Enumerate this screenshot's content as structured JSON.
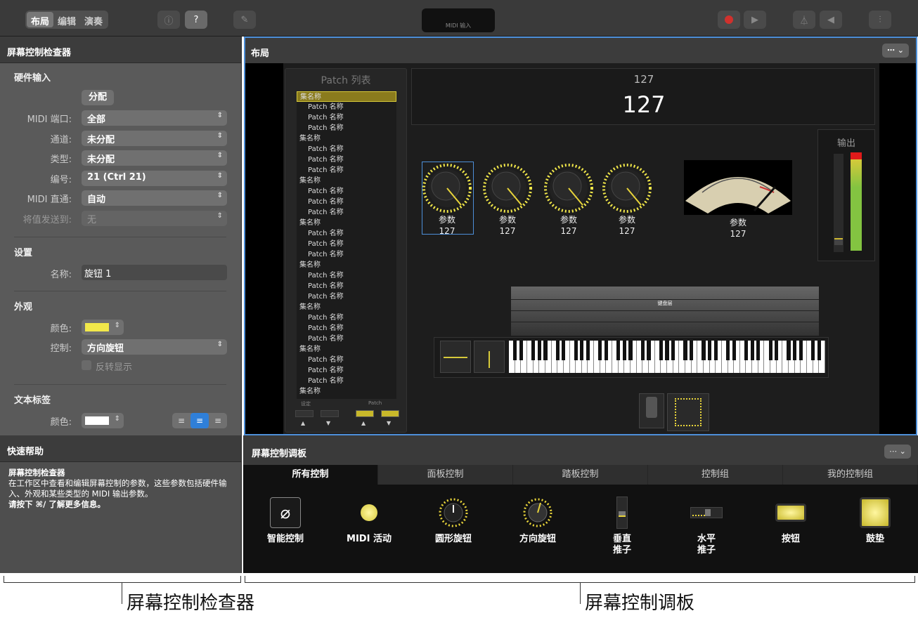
{
  "toolbar": {
    "mode_tabs": [
      "布局",
      "编辑",
      "演奏"
    ],
    "active_mode": "布局",
    "lcd_text": "MIDI 输入"
  },
  "inspector": {
    "title": "屏幕控制检查器",
    "hardware_section": "硬件输入",
    "assign_button": "分配",
    "fields": [
      {
        "label": "MIDI 端口:",
        "value": "全部"
      },
      {
        "label": "通道:",
        "value": "未分配"
      },
      {
        "label": "类型:",
        "value": "未分配"
      },
      {
        "label": "编号:",
        "value": "21 (Ctrl 21)"
      },
      {
        "label": "MIDI 直通:",
        "value": "自动"
      },
      {
        "label": "将值发送到:",
        "value": "无"
      }
    ],
    "settings_section": "设置",
    "name_label": "名称:",
    "name_value": "旋钮 1",
    "appearance_section": "外观",
    "color_label": "颜色:",
    "control_label": "控制:",
    "control_value": "方向旋钮",
    "invert_label": "反转显示",
    "text_label_section": "文本标签",
    "text_color_label": "颜色:"
  },
  "layout": {
    "title": "布局",
    "patch_list": {
      "title": "Patch 列表",
      "items": [
        {
          "text": "集名称",
          "type": "set",
          "selected": true
        },
        {
          "text": "Patch 名称",
          "type": "patch"
        },
        {
          "text": "Patch 名称",
          "type": "patch"
        },
        {
          "text": "Patch 名称",
          "type": "patch"
        },
        {
          "text": "集名称",
          "type": "set"
        },
        {
          "text": "Patch 名称",
          "type": "patch"
        },
        {
          "text": "Patch 名称",
          "type": "patch"
        },
        {
          "text": "Patch 名称",
          "type": "patch"
        },
        {
          "text": "集名称",
          "type": "set"
        },
        {
          "text": "Patch 名称",
          "type": "patch"
        },
        {
          "text": "Patch 名称",
          "type": "patch"
        },
        {
          "text": "Patch 名称",
          "type": "patch"
        },
        {
          "text": "集名称",
          "type": "set"
        },
        {
          "text": "Patch 名称",
          "type": "patch"
        },
        {
          "text": "Patch 名称",
          "type": "patch"
        },
        {
          "text": "Patch 名称",
          "type": "patch"
        },
        {
          "text": "集名称",
          "type": "set"
        },
        {
          "text": "Patch 名称",
          "type": "patch"
        },
        {
          "text": "Patch 名称",
          "type": "patch"
        },
        {
          "text": "Patch 名称",
          "type": "patch"
        },
        {
          "text": "集名称",
          "type": "set"
        },
        {
          "text": "Patch 名称",
          "type": "patch"
        },
        {
          "text": "Patch 名称",
          "type": "patch"
        },
        {
          "text": "Patch 名称",
          "type": "patch"
        },
        {
          "text": "集名称",
          "type": "set"
        },
        {
          "text": "Patch 名称",
          "type": "patch"
        },
        {
          "text": "Patch 名称",
          "type": "patch"
        },
        {
          "text": "Patch 名称",
          "type": "patch"
        },
        {
          "text": "集名称",
          "type": "set"
        }
      ],
      "footer_left": "设定",
      "footer_right": "Patch"
    },
    "display_small": "127",
    "display_large": "127",
    "knobs": [
      {
        "label": "参数",
        "value": "127"
      },
      {
        "label": "参数",
        "value": "127"
      },
      {
        "label": "参数",
        "value": "127"
      },
      {
        "label": "参数",
        "value": "127"
      }
    ],
    "meter": {
      "label": "参数",
      "value": "127"
    },
    "output_label": "输出",
    "keyboard_layer_label": "键盘层"
  },
  "help": {
    "title": "快速帮助",
    "heading": "屏幕控制检查器",
    "body": "在工作区中查看和编辑屏幕控制的参数，这些参数包括硬件输入、外观和某些类型的 MIDI 输出参数。",
    "more": "请按下 ⌘/ 了解更多信息。"
  },
  "palette": {
    "title": "屏幕控制调板",
    "tabs": [
      "所有控制",
      "面板控制",
      "踏板控制",
      "控制组",
      "我的控制组"
    ],
    "active_tab": "所有控制",
    "items": [
      {
        "label": "智能控制"
      },
      {
        "label": "MIDI 活动"
      },
      {
        "label": "圆形旋钮"
      },
      {
        "label": "方向旋钮"
      },
      {
        "label": "垂直\n推子"
      },
      {
        "label": "水平\n推子"
      },
      {
        "label": "按钮"
      },
      {
        "label": "鼓垫"
      }
    ]
  },
  "callouts": {
    "left": "屏幕控制检查器",
    "right": "屏幕控制调板"
  },
  "colors": {
    "accent_blue": "#4d8fd9",
    "knob_yellow": "#f2e84a",
    "record_red": "#d0312d",
    "selected_patch": "#8a7b1d"
  }
}
